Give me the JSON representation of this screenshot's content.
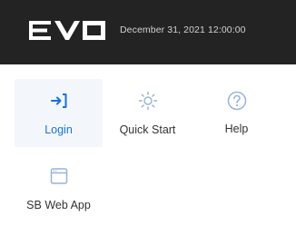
{
  "header": {
    "logo_text": "EVO",
    "datetime": "December 31, 2021 12:00:00",
    "background_color": "#232323"
  },
  "menu": {
    "accent_color": "#1a73d4",
    "items": [
      {
        "label": "Login",
        "icon": "login-icon",
        "active": true
      },
      {
        "label": "Quick Start",
        "icon": "sun-icon",
        "active": false
      },
      {
        "label": "Help",
        "icon": "question-circle-icon",
        "active": false
      },
      {
        "label": "SB Web App",
        "icon": "browser-window-icon",
        "active": false
      }
    ]
  }
}
